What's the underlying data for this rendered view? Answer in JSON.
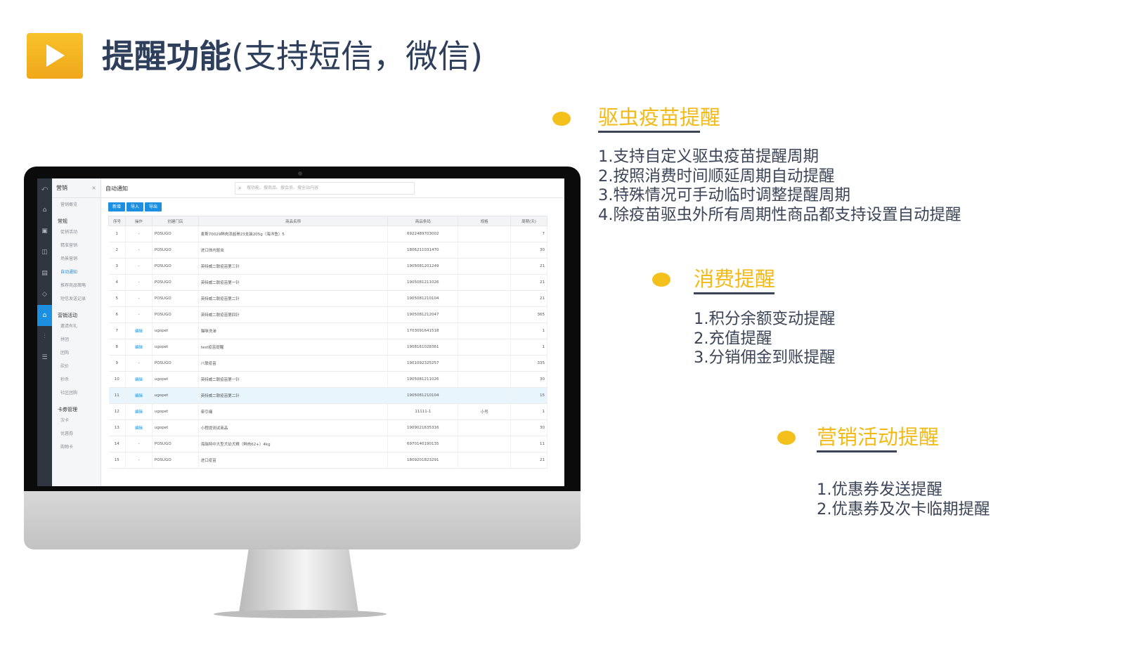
{
  "title": {
    "bold": "提醒功能",
    "light": "(支持短信，微信)"
  },
  "app": {
    "module": "营销",
    "close_glyph": "×",
    "tab": "自动通知",
    "search_placeholder": "搜功能、搜商品、搜会员、搜全站内容",
    "buttons": [
      "新增",
      "导入",
      "导出"
    ],
    "menu": [
      {
        "type": "item",
        "label": "营销概览"
      },
      {
        "type": "group",
        "label": "常规"
      },
      {
        "type": "item",
        "label": "促销活动"
      },
      {
        "type": "item",
        "label": "精准营销"
      },
      {
        "type": "item",
        "label": "场景营销"
      },
      {
        "type": "item",
        "label": "自动通知",
        "active": true
      },
      {
        "type": "item",
        "label": "推荐商品策略"
      },
      {
        "type": "item",
        "label": "短信发送记录"
      },
      {
        "type": "group",
        "label": "营销活动"
      },
      {
        "type": "item",
        "label": "邀请有礼"
      },
      {
        "type": "item",
        "label": "拼团"
      },
      {
        "type": "item",
        "label": "团购"
      },
      {
        "type": "item",
        "label": "砍价"
      },
      {
        "type": "item",
        "label": "秒杀"
      },
      {
        "type": "item",
        "label": "社区团购"
      },
      {
        "type": "group",
        "label": "卡券管理"
      },
      {
        "type": "item",
        "label": "次卡"
      },
      {
        "type": "item",
        "label": "优惠券"
      },
      {
        "type": "item",
        "label": "购物卡"
      }
    ],
    "icons": [
      "home-icon",
      "store-icon",
      "box-icon",
      "list-icon",
      "tag-icon",
      "marketing-icon",
      "chart-icon",
      "settings-icon"
    ],
    "columns": [
      "序号",
      "操作",
      "创建门店",
      "商品名称",
      "商品条码",
      "规格",
      "周期(天)"
    ],
    "rows": [
      [
        "1",
        "-",
        "POSUGO",
        "麦斯70029鲜肉添盐骨23支装205g（海洋鱼）5",
        "6922489703002",
        "",
        "7"
      ],
      [
        "2",
        "-",
        "POSUGO",
        "进口体内驱虫",
        "1806211031470",
        "",
        "30"
      ],
      [
        "3",
        "-",
        "POSUGO",
        "英特威二联疫苗第三针",
        "1905081201249",
        "",
        "21"
      ],
      [
        "4",
        "-",
        "POSUGO",
        "英特威二联疫苗第一针",
        "1905081211026",
        "",
        "21"
      ],
      [
        "5",
        "-",
        "POSUGO",
        "英特威二联疫苗第二针",
        "1905081210104",
        "",
        "21"
      ],
      [
        "6",
        "-",
        "POSUGO",
        "英特威二联疫苗第四针",
        "1905081212047",
        "",
        "365"
      ],
      [
        "7",
        "编辑",
        "ugopet",
        "猫咪洗澡",
        "1703091641518",
        "",
        "1"
      ],
      [
        "8",
        "编辑",
        "ugopet",
        "test疫苗提醒",
        "1908161028361",
        "",
        "1"
      ],
      [
        "9",
        "-",
        "POSUGO",
        "八联疫苗",
        "1901092325257",
        "",
        "335"
      ],
      [
        "10",
        "编辑",
        "ugopet",
        "英特威二联疫苗第一针",
        "1905081211026",
        "",
        "30"
      ],
      [
        "11",
        "编辑",
        "ugopet",
        "英特威二联疫苗第二针",
        "1905081210104",
        "",
        "15"
      ],
      [
        "12",
        "编辑",
        "ugopet",
        "牵引绳",
        "11111-1",
        "小号",
        "1"
      ],
      [
        "13",
        "编辑",
        "ugopet",
        "小程提测试商品",
        "1909021635316",
        "",
        "30"
      ],
      [
        "14",
        "-",
        "POSUGO",
        "海瑞特中大型犬幼犬粮（鲜肉62+）4kg",
        "6970140190135",
        "",
        "11"
      ],
      [
        "15",
        "-",
        "POSUGO",
        "进口疫苗",
        "1809201823291",
        "",
        "21"
      ]
    ],
    "highlighted_row": 11
  },
  "sections": [
    {
      "title": "驱虫疫苗提醒",
      "items": [
        "1.支持自定义驱虫疫苗提醒周期",
        "2.按照消费时间顺延周期自动提醒",
        "3.特殊情况可手动临时调整提醒周期",
        "4.除疫苗驱虫外所有周期性商品都支持设置自动提醒"
      ]
    },
    {
      "title": "消费提醒",
      "items": [
        "1.积分余额变动提醒",
        "2.充值提醒",
        "3.分销佣金到账提醒"
      ]
    },
    {
      "title": "营销活动提醒",
      "items": [
        "1.优惠券发送提醒",
        "2.优惠券及次卡临期提醒"
      ]
    }
  ],
  "colors": {
    "accent": "#f2ba18",
    "title": "#2e3f5c",
    "text": "#3b4557",
    "app_blue": "#1d8fe1"
  }
}
